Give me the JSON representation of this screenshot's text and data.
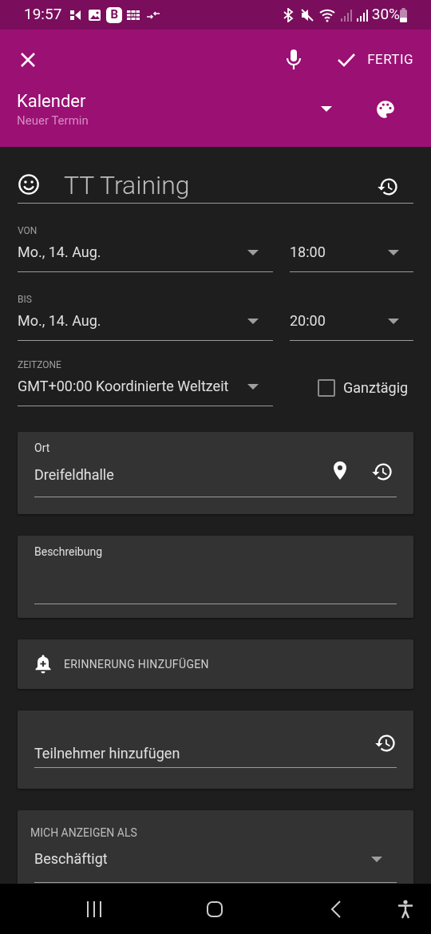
{
  "status_bar": {
    "time": "19:57",
    "badge": "B",
    "battery": "30%"
  },
  "app_bar": {
    "done": "FERTIG",
    "calendar": "Kalender",
    "subtitle": "Neuer Termin"
  },
  "title": {
    "value": "TT Training"
  },
  "from": {
    "label": "VON",
    "date": "Mo., 14. Aug.",
    "time": "18:00"
  },
  "to": {
    "label": "BIS",
    "date": "Mo., 14. Aug.",
    "time": "20:00"
  },
  "timezone": {
    "label": "ZEITZONE",
    "value": "GMT+00:00 Koordinierte Weltzeit"
  },
  "all_day": {
    "label": "Ganztägig",
    "checked": false
  },
  "location": {
    "label": "Ort",
    "value": "Dreifeldhalle"
  },
  "description": {
    "label": "Beschreibung"
  },
  "reminder": {
    "label": "ERINNERUNG HINZUFÜGEN"
  },
  "attendees": {
    "placeholder": "Teilnehmer hinzufügen"
  },
  "show_as": {
    "label": "MICH ANZEIGEN ALS",
    "value": "Beschäftigt"
  }
}
